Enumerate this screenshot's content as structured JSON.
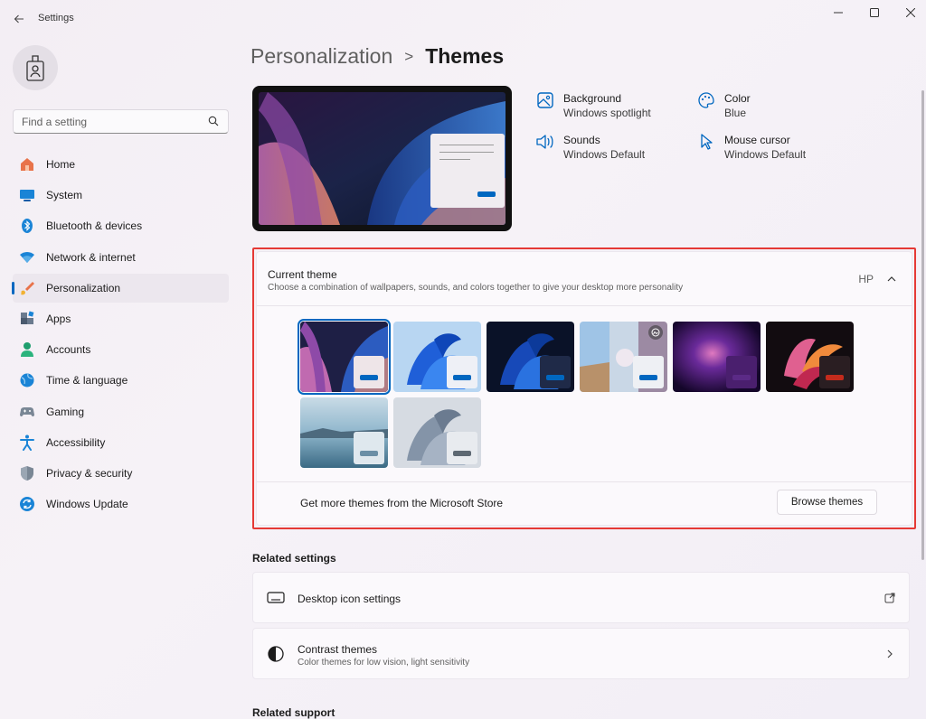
{
  "window": {
    "title": "Settings",
    "controls": [
      "minimize",
      "maximize",
      "close"
    ]
  },
  "sidebar": {
    "search_placeholder": "Find a setting",
    "items": [
      {
        "label": "Home",
        "icon": "home-icon"
      },
      {
        "label": "System",
        "icon": "system-icon"
      },
      {
        "label": "Bluetooth & devices",
        "icon": "bluetooth-icon"
      },
      {
        "label": "Network & internet",
        "icon": "network-icon"
      },
      {
        "label": "Personalization",
        "icon": "personalization-icon",
        "active": true
      },
      {
        "label": "Apps",
        "icon": "apps-icon"
      },
      {
        "label": "Accounts",
        "icon": "accounts-icon"
      },
      {
        "label": "Time & language",
        "icon": "time-language-icon"
      },
      {
        "label": "Gaming",
        "icon": "gaming-icon"
      },
      {
        "label": "Accessibility",
        "icon": "accessibility-icon"
      },
      {
        "label": "Privacy & security",
        "icon": "privacy-security-icon"
      },
      {
        "label": "Windows Update",
        "icon": "windows-update-icon"
      }
    ]
  },
  "breadcrumb": {
    "parent": "Personalization",
    "separator": ">",
    "current": "Themes"
  },
  "theme_properties": [
    {
      "label": "Background",
      "value": "Windows spotlight",
      "icon": "picture-icon"
    },
    {
      "label": "Color",
      "value": "Blue",
      "icon": "palette-icon"
    },
    {
      "label": "Sounds",
      "value": "Windows Default",
      "icon": "speaker-icon"
    },
    {
      "label": "Mouse cursor",
      "value": "Windows Default",
      "icon": "cursor-icon"
    }
  ],
  "current_theme": {
    "title": "Current theme",
    "description": "Choose a combination of wallpapers, sounds, and colors together to give your desktop more personality",
    "selected_name": "HP",
    "store_label": "Get more themes from the Microsoft Store",
    "browse_button": "Browse themes",
    "themes": [
      {
        "name": "theme-1",
        "accent": "#0067c0",
        "selected": true
      },
      {
        "name": "theme-2",
        "accent": "#0067c0"
      },
      {
        "name": "theme-3",
        "accent": "#0067c0"
      },
      {
        "name": "theme-4",
        "accent": "#0067c0",
        "badge": "spotlight-icon"
      },
      {
        "name": "theme-5",
        "accent": "#5b2a86"
      },
      {
        "name": "theme-6",
        "accent": "#c42b1c"
      },
      {
        "name": "theme-7",
        "accent": "#6b8fa6"
      },
      {
        "name": "theme-8",
        "accent": "#5d6872"
      }
    ]
  },
  "related_settings": {
    "title": "Related settings",
    "items": [
      {
        "label": "Desktop icon settings",
        "icon": "monitor-icon",
        "trail": "open-external-icon"
      },
      {
        "label": "Contrast themes",
        "sub": "Color themes for low vision, light sensitivity",
        "icon": "contrast-icon",
        "trail": "chevron-right-icon"
      }
    ]
  },
  "related_support": {
    "title": "Related support"
  },
  "colors": {
    "accent": "#0067c0",
    "highlight_border": "#e53935"
  }
}
